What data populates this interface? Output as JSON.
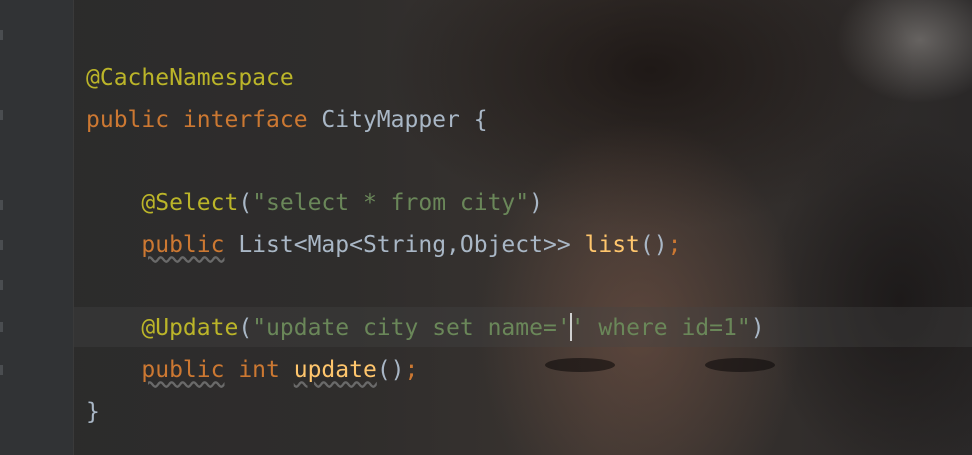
{
  "editor": {
    "lines": [
      {
        "tokens": [
          {
            "text": "@CacheNamespace",
            "type": "anno"
          }
        ]
      },
      {
        "tokens": [
          {
            "text": "public interface",
            "type": "kw"
          },
          {
            "text": " CityMapper {",
            "type": "plain"
          }
        ]
      },
      {
        "tokens": []
      },
      {
        "tokens": [
          {
            "text": "    ",
            "type": "plain"
          },
          {
            "text": "@Select",
            "type": "anno"
          },
          {
            "text": "(",
            "type": "plain"
          },
          {
            "text": "\"select * from city\"",
            "type": "str"
          },
          {
            "text": ")",
            "type": "plain"
          }
        ]
      },
      {
        "tokens": [
          {
            "text": "    ",
            "type": "plain"
          },
          {
            "text": "public",
            "type": "kw",
            "unused": true
          },
          {
            "text": " List<Map<String,Object>> ",
            "type": "plain"
          },
          {
            "text": "list",
            "type": "fn"
          },
          {
            "text": "()",
            "type": "plain"
          },
          {
            "text": ";",
            "type": "kw"
          }
        ]
      },
      {
        "tokens": []
      },
      {
        "tokens": [
          {
            "text": "    ",
            "type": "plain"
          },
          {
            "text": "@Update",
            "type": "anno"
          },
          {
            "text": "(",
            "type": "plain"
          },
          {
            "text": "\"update city set name='",
            "type": "str"
          },
          {
            "caret": true
          },
          {
            "text": "' where id=1\"",
            "type": "str"
          },
          {
            "text": ")",
            "type": "plain"
          }
        ]
      },
      {
        "tokens": [
          {
            "text": "    ",
            "type": "plain"
          },
          {
            "text": "public",
            "type": "kw",
            "unused": true
          },
          {
            "text": " int ",
            "type": "kw"
          },
          {
            "text": "update",
            "type": "fn",
            "unused": true
          },
          {
            "text": "()",
            "type": "plain"
          },
          {
            "text": ";",
            "type": "kw"
          }
        ]
      },
      {
        "tokens": [
          {
            "text": "}",
            "type": "plain"
          }
        ]
      }
    ]
  },
  "colors": {
    "annotation": "#bbb529",
    "keyword": "#cc7832",
    "string": "#6a8759",
    "plain": "#a9b7c6",
    "method": "#ffc66d",
    "background": "#2b2b2b",
    "gutter": "#313335"
  }
}
